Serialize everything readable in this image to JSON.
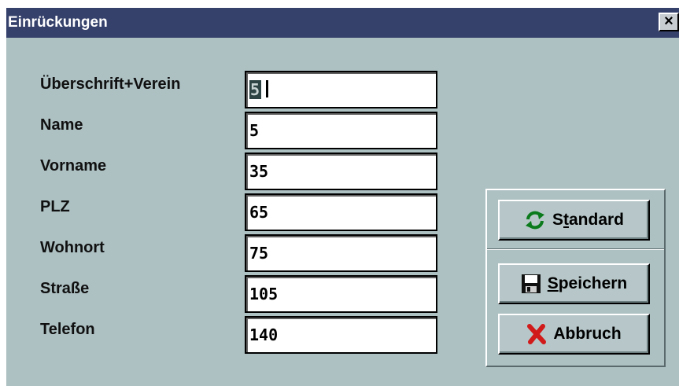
{
  "window": {
    "title": "Einrückungen",
    "close_glyph": "×"
  },
  "fields": [
    {
      "label": "Überschrift+Verein",
      "value": "5"
    },
    {
      "label": "Name",
      "value": "5"
    },
    {
      "label": "Vorname",
      "value": "35"
    },
    {
      "label": "PLZ",
      "value": "65"
    },
    {
      "label": "Wohnort",
      "value": "75"
    },
    {
      "label": "Straße",
      "value": "105"
    },
    {
      "label": "Telefon",
      "value": "140"
    }
  ],
  "buttons": {
    "standard": {
      "pre": "S",
      "underline": "t",
      "post": "andard",
      "icon": "refresh-icon"
    },
    "speichern": {
      "pre": "",
      "underline": "S",
      "post": "peichern",
      "icon": "floppy-disk-icon"
    },
    "abbruch": {
      "label": "Abbruch",
      "icon": "red-x-icon"
    }
  },
  "colors": {
    "titlebar": "#35416b",
    "client": "#adc0c2",
    "button_face": "#b7c7c9"
  }
}
